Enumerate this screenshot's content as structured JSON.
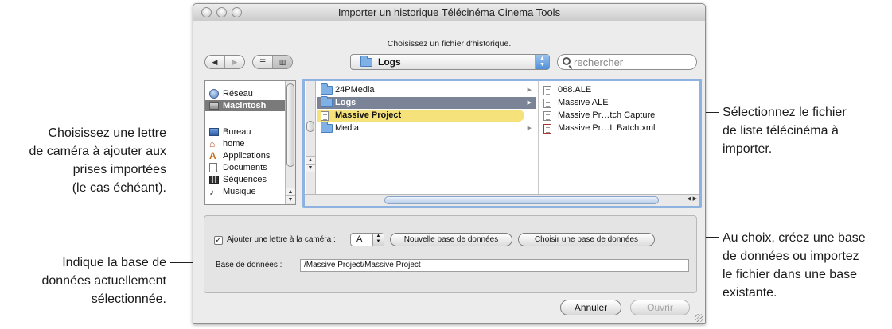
{
  "callouts": {
    "camera_letter": [
      "Choisissez une lettre",
      "de caméra à ajouter aux",
      "prises importées",
      "(le cas échéant)."
    ],
    "current_db": [
      "Indique la base de",
      "données actuellement",
      "sélectionnée."
    ],
    "select_file": [
      "Sélectionnez le fichier",
      "de liste télécinéma à",
      "importer."
    ],
    "create_or_import": [
      "Au choix, créez une base",
      "de données ou importez",
      "le fichier dans une base",
      "existante."
    ]
  },
  "window": {
    "title": "Importer un historique Télécinéma Cinema Tools",
    "prompt": "Choisissez un fichier d'historique."
  },
  "toolbar": {
    "back_glyph": "◀",
    "forward_glyph": "▶",
    "list_glyph": "☰",
    "columns_glyph": "▥",
    "location": "Logs",
    "popup_arrows": "▲▼",
    "search_placeholder": "rechercher"
  },
  "sidebar": {
    "items": [
      {
        "label": "Réseau",
        "icon": "globe-icon",
        "selected": false
      },
      {
        "label": "Macintosh",
        "icon": "hard-drive-icon",
        "selected": true
      },
      {
        "label": "Bureau",
        "icon": "desktop-icon",
        "selected": false
      },
      {
        "label": "home",
        "icon": "home-icon",
        "selected": false
      },
      {
        "label": "Applications",
        "icon": "applications-icon",
        "selected": false
      },
      {
        "label": "Documents",
        "icon": "documents-icon",
        "selected": false
      },
      {
        "label": "Séquences",
        "icon": "movies-icon",
        "selected": false
      },
      {
        "label": "Musique",
        "icon": "music-icon",
        "selected": false
      }
    ]
  },
  "browser": {
    "column1": [
      {
        "name": "24PMedia",
        "icon": "folder-icon",
        "state": "normal",
        "has_children": true
      },
      {
        "name": "Logs",
        "icon": "folder-icon",
        "state": "selected",
        "has_children": true
      },
      {
        "name": "Massive Project",
        "icon": "database-icon",
        "state": "highlighted",
        "has_children": false
      },
      {
        "name": "Media",
        "icon": "folder-icon",
        "state": "normal",
        "has_children": true
      }
    ],
    "column2": [
      {
        "name": "068.ALE",
        "icon": "document-icon"
      },
      {
        "name": "Massive ALE",
        "icon": "document-icon"
      },
      {
        "name": "Massive Pr…tch Capture",
        "icon": "document-icon"
      },
      {
        "name": "Massive Pr…L Batch.xml",
        "icon": "xml-file-icon"
      }
    ],
    "child_arrow": "▶"
  },
  "options": {
    "camera_checkbox_label": "Ajouter une lettre à la caméra :",
    "camera_checked": true,
    "camera_letter": "A",
    "new_db_button": "Nouvelle base de données",
    "choose_db_button": "Choisir une base de données",
    "db_label": "Base de données :",
    "db_path": "/Massive Project/Massive Project"
  },
  "buttons": {
    "cancel": "Annuler",
    "open": "Ouvrir"
  },
  "colors": {
    "selection": "#7b8496",
    "highlight": "#f6e27a",
    "focus_ring": "#8fb3e0"
  }
}
